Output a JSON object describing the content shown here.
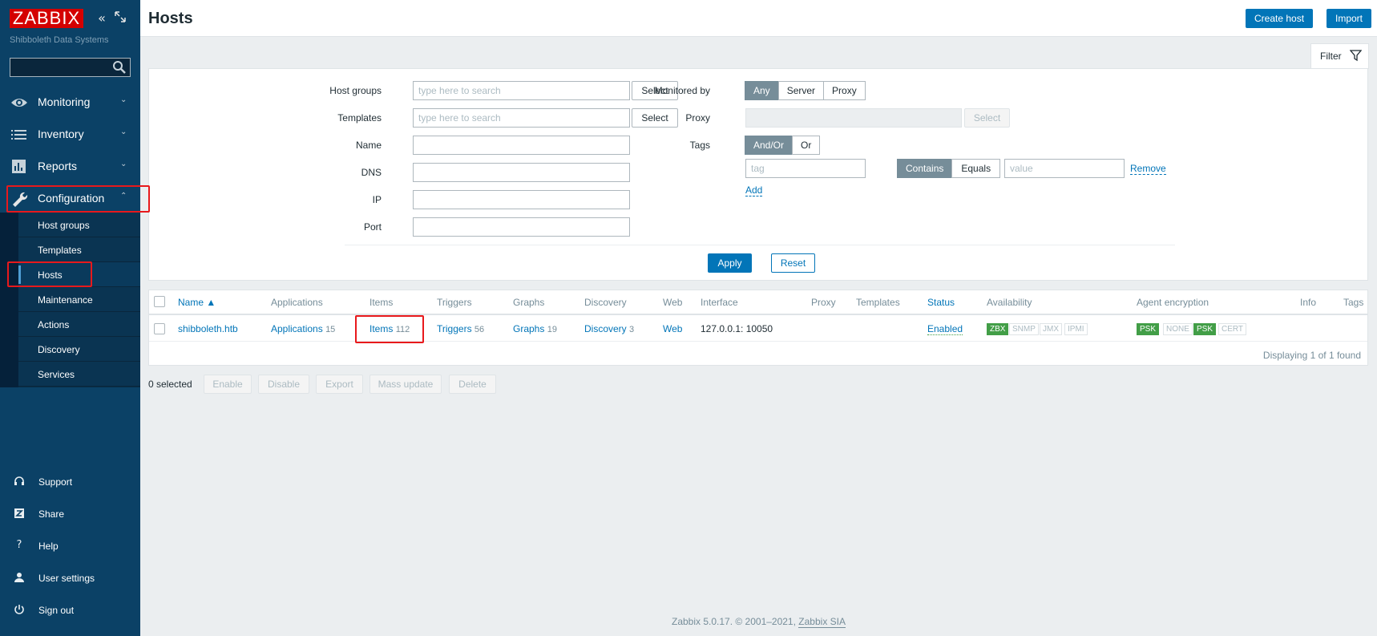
{
  "sidebar": {
    "logo": "ZABBIX",
    "subtitle": "Shibboleth Data Systems",
    "search_value": "",
    "menu": [
      {
        "label": "Monitoring"
      },
      {
        "label": "Inventory"
      },
      {
        "label": "Reports"
      },
      {
        "label": "Configuration"
      }
    ],
    "submenu": [
      {
        "label": "Host groups"
      },
      {
        "label": "Templates"
      },
      {
        "label": "Hosts"
      },
      {
        "label": "Maintenance"
      },
      {
        "label": "Actions"
      },
      {
        "label": "Discovery"
      },
      {
        "label": "Services"
      }
    ],
    "bottom": [
      {
        "label": "Support"
      },
      {
        "label": "Share"
      },
      {
        "label": "Help"
      },
      {
        "label": "User settings"
      },
      {
        "label": "Sign out"
      }
    ]
  },
  "header": {
    "title": "Hosts",
    "create_host": "Create host",
    "import": "Import"
  },
  "filter": {
    "tab_label": "Filter",
    "host_groups_label": "Host groups",
    "templates_label": "Templates",
    "name_label": "Name",
    "dns_label": "DNS",
    "ip_label": "IP",
    "port_label": "Port",
    "placeholder_search": "type here to search",
    "select": "Select",
    "monitored_by_label": "Monitored by",
    "monitored_by_options": [
      "Any",
      "Server",
      "Proxy"
    ],
    "proxy_label": "Proxy",
    "tags_label": "Tags",
    "tags_logic": [
      "And/Or",
      "Or"
    ],
    "tag_placeholder": "tag",
    "tag_operators": [
      "Contains",
      "Equals"
    ],
    "value_placeholder": "value",
    "remove": "Remove",
    "add": "Add",
    "apply": "Apply",
    "reset": "Reset"
  },
  "table": {
    "columns": [
      "Name ▲",
      "Applications",
      "Items",
      "Triggers",
      "Graphs",
      "Discovery",
      "Web",
      "Interface",
      "Proxy",
      "Templates",
      "Status",
      "Availability",
      "Agent encryption",
      "Info",
      "Tags"
    ],
    "row": {
      "name": "shibboleth.htb",
      "applications": "Applications",
      "applications_count": "15",
      "items": "Items",
      "items_count": "112",
      "triggers": "Triggers",
      "triggers_count": "56",
      "graphs": "Graphs",
      "graphs_count": "19",
      "discovery": "Discovery",
      "discovery_count": "3",
      "web": "Web",
      "interface": "127.0.0.1: 10050",
      "status": "Enabled",
      "availability": [
        "ZBX",
        "SNMP",
        "JMX",
        "IPMI"
      ],
      "encryption": [
        "PSK",
        "NONE",
        "PSK",
        "CERT"
      ]
    },
    "displaying": "Displaying 1 of 1 found"
  },
  "actions": {
    "selected": "0 selected",
    "enable": "Enable",
    "disable": "Disable",
    "export": "Export",
    "mass_update": "Mass update",
    "delete": "Delete"
  },
  "footer": {
    "text": "Zabbix 5.0.17. © 2001–2021,",
    "company": "Zabbix SIA"
  },
  "colors": {
    "sidebar_bg": "#0b4166",
    "brand_red": "#d40000",
    "link_blue": "#0275b8",
    "enabled_green": "#429e47",
    "highlight_red": "#e8191c"
  }
}
